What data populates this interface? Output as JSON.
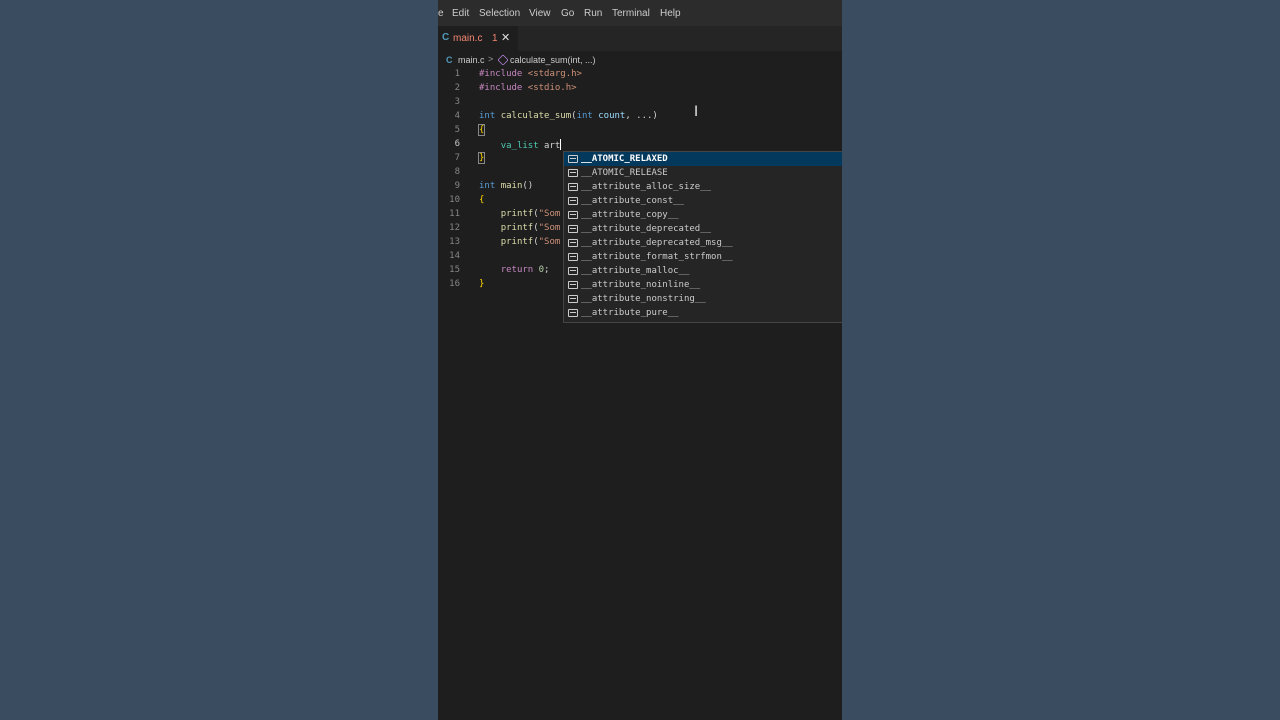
{
  "menubar": {
    "items": [
      "e",
      "Edit",
      "Selection",
      "View",
      "Go",
      "Run",
      "Terminal",
      "Help"
    ]
  },
  "tab": {
    "file_icon": "C",
    "filename": "main.c",
    "problem_count": "1",
    "close_glyph": "✕"
  },
  "breadcrumb": {
    "file_icon": "C",
    "file": "main.c",
    "separator": ">",
    "symbol_icon": "method-cube-icon",
    "symbol": "calculate_sum(int, ...)"
  },
  "editor": {
    "current_line": 6,
    "lines": [
      {
        "n": "1",
        "code": "#include <stdarg.h>"
      },
      {
        "n": "2",
        "code": "#include <stdio.h>"
      },
      {
        "n": "3",
        "code": ""
      },
      {
        "n": "4",
        "code": "int calculate_sum(int count, ...)"
      },
      {
        "n": "5",
        "code": "{"
      },
      {
        "n": "6",
        "code": "    va_list art"
      },
      {
        "n": "7",
        "code": "}"
      },
      {
        "n": "8",
        "code": ""
      },
      {
        "n": "9",
        "code": "int main()"
      },
      {
        "n": "10",
        "code": "{"
      },
      {
        "n": "11",
        "code": "    printf(\"Som"
      },
      {
        "n": "12",
        "code": "    printf(\"Som"
      },
      {
        "n": "13",
        "code": "    printf(\"Som"
      },
      {
        "n": "14",
        "code": ""
      },
      {
        "n": "15",
        "code": "    return 0;"
      },
      {
        "n": "16",
        "code": "}"
      }
    ]
  },
  "suggestions": {
    "selected_index": 0,
    "items": [
      "__ATOMIC_RELAXED",
      "__ATOMIC_RELEASE",
      "__attribute_alloc_size__",
      "__attribute_const__",
      "__attribute_copy__",
      "__attribute_deprecated__",
      "__attribute_deprecated_msg__",
      "__attribute_format_strfmon__",
      "__attribute_malloc__",
      "__attribute_noinline__",
      "__attribute_nonstring__",
      "__attribute_pure__"
    ]
  },
  "mouse_cursor_glyph": "I",
  "colors": {
    "background": "#3a4d60",
    "editor_bg": "#1e1e1e",
    "selection_bg": "#04395e",
    "keyword": "#569cd6",
    "function": "#dcdcaa",
    "preprocessor": "#c586c0",
    "string": "#ce9178",
    "error_tab": "#f48771"
  }
}
